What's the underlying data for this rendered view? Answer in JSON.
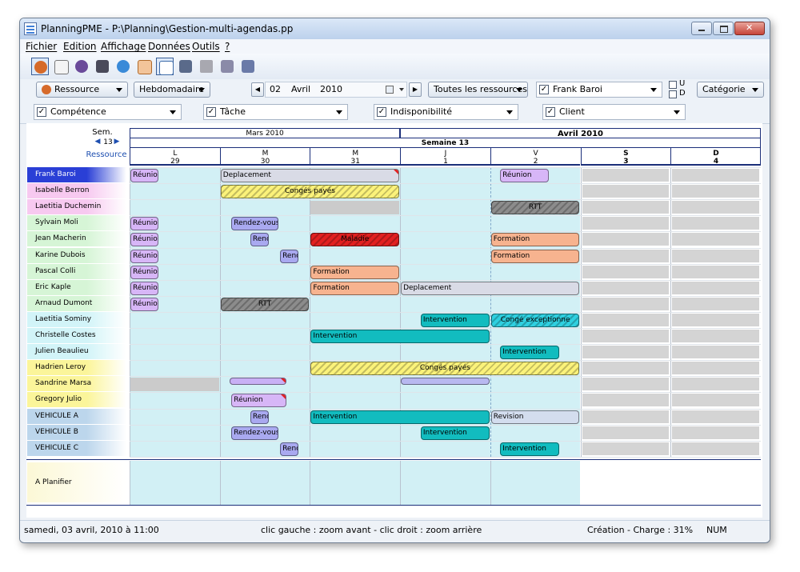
{
  "window": {
    "title": "PlanningPME - P:\\Planning\\Gestion-multi-agendas.pp"
  },
  "menu": [
    "Fichier",
    "Edition",
    "Affichage",
    "Données",
    "Outils",
    "?"
  ],
  "toolbar_icons": [
    "resources-icon",
    "calendar-icon",
    "users-icon",
    "book-icon",
    "globe-icon",
    "agenda-icon",
    "add-task-icon",
    "report-icon",
    "tools-icon",
    "filter-icon",
    "export-icon"
  ],
  "toolbar2": {
    "ressource_label": "Ressource",
    "view": "Hebdomadaire",
    "day": "02",
    "month": "Avril",
    "year": "2010",
    "filter": "Toutes les ressources",
    "person": "Frank Baroi",
    "u_label": "U",
    "d_label": "D",
    "category": "Catégorie"
  },
  "filters": [
    {
      "label": "Compétence",
      "checked": "✓"
    },
    {
      "label": "Tâche",
      "checked": "✓"
    },
    {
      "label": "Indisponibilité",
      "checked": "✓"
    },
    {
      "label": "Client",
      "checked": "✓"
    }
  ],
  "header": {
    "sem_label": "Sem.",
    "week_num": "13",
    "resource_label": "Ressource",
    "month1": "Mars 2010",
    "month2": "Avril 2010",
    "week_title": "Semaine 13",
    "days": [
      {
        "letter": "L",
        "num": "29"
      },
      {
        "letter": "M",
        "num": "30"
      },
      {
        "letter": "M",
        "num": "31"
      },
      {
        "letter": "J",
        "num": "1"
      },
      {
        "letter": "V",
        "num": "2"
      },
      {
        "letter": "S",
        "num": "3"
      },
      {
        "letter": "D",
        "num": "4"
      }
    ]
  },
  "resources": [
    {
      "name": "Frank Baroi",
      "color": "#2a3fd6",
      "text": "#ffffff"
    },
    {
      "name": "Isabelle Berron",
      "color": "#f7c9f0",
      "text": "#000000"
    },
    {
      "name": "Laetitia Duchemin",
      "color": "#f7c9f0",
      "text": "#000000"
    },
    {
      "name": "Sylvain Moli",
      "color": "#d6f5d6",
      "text": "#000000"
    },
    {
      "name": "Jean Macherin",
      "color": "#d6f5d6",
      "text": "#000000"
    },
    {
      "name": "Karine Dubois",
      "color": "#d6f5d6",
      "text": "#000000"
    },
    {
      "name": "Pascal Colli",
      "color": "#d6f5d6",
      "text": "#000000"
    },
    {
      "name": "Eric Kaple",
      "color": "#d6f5d6",
      "text": "#000000"
    },
    {
      "name": "Arnaud Dumont",
      "color": "#d6f5d6",
      "text": "#000000"
    },
    {
      "name": "Laetitia Sominy",
      "color": "#d2f4f8",
      "text": "#000000"
    },
    {
      "name": "Christelle Costes",
      "color": "#d2f4f8",
      "text": "#000000"
    },
    {
      "name": "Julien Beaulieu",
      "color": "#d2f4f8",
      "text": "#000000"
    },
    {
      "name": "Hadrien Leroy",
      "color": "#fbf59a",
      "text": "#000000"
    },
    {
      "name": "Sandrine Marsa",
      "color": "#fbf59a",
      "text": "#000000"
    },
    {
      "name": "Gregory Julio",
      "color": "#fbf59a",
      "text": "#000000"
    },
    {
      "name": "VEHICULE A",
      "color": "#bcd6ec",
      "text": "#000000"
    },
    {
      "name": "VEHICULE B",
      "color": "#bcd6ec",
      "text": "#000000"
    },
    {
      "name": "VEHICULE C",
      "color": "#bcd6ec",
      "text": "#000000"
    }
  ],
  "planifier_label": "A Planifier",
  "events": [
    {
      "row": 0,
      "start": 0,
      "end": 0.33,
      "label": "Réunion",
      "color": "#d7b6f7",
      "center": false,
      "hatch": false,
      "flag": false
    },
    {
      "row": 0,
      "start": 1,
      "end": 3,
      "label": "Deplacement",
      "color": "#d9dbe6",
      "center": false,
      "hatch": false,
      "flag": true
    },
    {
      "row": 0,
      "start": 4.1,
      "end": 4.66,
      "label": "Réunion",
      "color": "#d7b6f7",
      "center": false,
      "hatch": false,
      "flag": false
    },
    {
      "row": 1,
      "start": 1,
      "end": 3,
      "label": "Congés payés",
      "color": "#fbf27a",
      "center": true,
      "hatch": true,
      "flag": false
    },
    {
      "row": 2,
      "start": 2,
      "end": 3,
      "label": "",
      "color": "#cbcbcb",
      "center": false,
      "hatch": false,
      "flag": false,
      "plain": true
    },
    {
      "row": 2,
      "start": 4,
      "end": 5,
      "label": "RTT",
      "color": "#8c8c8c",
      "center": true,
      "hatch": true,
      "flag": false
    },
    {
      "row": 3,
      "start": 0,
      "end": 0.33,
      "label": "Réunion",
      "color": "#d7b6f7",
      "center": false,
      "hatch": false,
      "flag": false
    },
    {
      "row": 3,
      "start": 1.12,
      "end": 1.66,
      "label": "Rendez-vous",
      "color": "#a9a9f0",
      "center": false,
      "hatch": false,
      "flag": false
    },
    {
      "row": 4,
      "start": 0,
      "end": 0.33,
      "label": "Réunion",
      "color": "#d7b6f7",
      "center": false,
      "hatch": false,
      "flag": false
    },
    {
      "row": 4,
      "start": 1.33,
      "end": 1.55,
      "label": "Renc",
      "color": "#a9a9f0",
      "center": false,
      "hatch": false,
      "flag": false
    },
    {
      "row": 4,
      "start": 2,
      "end": 3,
      "label": "Maladie",
      "color": "#e22020",
      "center": true,
      "hatch": true,
      "flag": false
    },
    {
      "row": 4,
      "start": 4,
      "end": 5,
      "label": "Formation",
      "color": "#f7b38f",
      "center": false,
      "hatch": false,
      "flag": false
    },
    {
      "row": 5,
      "start": 0,
      "end": 0.33,
      "label": "Réunion",
      "color": "#d7b6f7",
      "center": false,
      "hatch": false,
      "flag": false
    },
    {
      "row": 5,
      "start": 1.66,
      "end": 1.88,
      "label": "Renc",
      "color": "#a9a9f0",
      "center": false,
      "hatch": false,
      "flag": false
    },
    {
      "row": 5,
      "start": 4,
      "end": 5,
      "label": "Formation",
      "color": "#f7b38f",
      "center": false,
      "hatch": false,
      "flag": false
    },
    {
      "row": 6,
      "start": 0,
      "end": 0.33,
      "label": "Réunion",
      "color": "#d7b6f7",
      "center": false,
      "hatch": false,
      "flag": false
    },
    {
      "row": 6,
      "start": 2,
      "end": 3,
      "label": "Formation",
      "color": "#f7b38f",
      "center": false,
      "hatch": false,
      "flag": false
    },
    {
      "row": 7,
      "start": 0,
      "end": 0.33,
      "label": "Réunion",
      "color": "#d7b6f7",
      "center": false,
      "hatch": false,
      "flag": false
    },
    {
      "row": 7,
      "start": 2,
      "end": 3,
      "label": "Formation",
      "color": "#f7b38f",
      "center": false,
      "hatch": false,
      "flag": false
    },
    {
      "row": 7,
      "start": 3,
      "end": 5,
      "label": "Deplacement",
      "color": "#d9dbe6",
      "center": false,
      "hatch": false,
      "flag": false
    },
    {
      "row": 8,
      "start": 0,
      "end": 0.33,
      "label": "Réunion",
      "color": "#d7b6f7",
      "center": false,
      "hatch": false,
      "flag": false
    },
    {
      "row": 8,
      "start": 1,
      "end": 2,
      "label": "RTT",
      "color": "#8c8c8c",
      "center": true,
      "hatch": true,
      "flag": false
    },
    {
      "row": 9,
      "start": 3.22,
      "end": 4,
      "label": "Intervention",
      "color": "#12bcbf",
      "center": false,
      "hatch": false,
      "flag": false
    },
    {
      "row": 9,
      "start": 4,
      "end": 5,
      "label": "Congé exceptionne",
      "color": "#2fd0e0",
      "center": true,
      "hatch": true,
      "flag": false
    },
    {
      "row": 10,
      "start": 2,
      "end": 4,
      "label": "Intervention",
      "color": "#12bcbf",
      "center": false,
      "hatch": false,
      "flag": false
    },
    {
      "row": 11,
      "start": 4.1,
      "end": 4.77,
      "label": "Intervention",
      "color": "#12bcbf",
      "center": false,
      "hatch": false,
      "flag": false
    },
    {
      "row": 12,
      "start": 2,
      "end": 5,
      "label": "Congés payés",
      "color": "#fbf27a",
      "center": true,
      "hatch": true,
      "flag": false
    },
    {
      "row": 13,
      "start": 0,
      "end": 1,
      "label": "",
      "color": "#cbcbcb",
      "center": false,
      "hatch": false,
      "flag": false,
      "plain": true
    },
    {
      "row": 13,
      "start": 1.1,
      "end": 1.75,
      "label": "",
      "color": "#c8b0f5",
      "center": false,
      "hatch": false,
      "flag": true,
      "thin": true
    },
    {
      "row": 13,
      "start": 3,
      "end": 4,
      "label": "",
      "color": "#b8b8f0",
      "center": false,
      "hatch": false,
      "flag": false,
      "thin": true
    },
    {
      "row": 14,
      "start": 1.12,
      "end": 1.75,
      "label": "Réunion",
      "color": "#d7b6f7",
      "center": false,
      "hatch": false,
      "flag": true
    },
    {
      "row": 15,
      "start": 1.33,
      "end": 1.55,
      "label": "Renc",
      "color": "#a9a9f0",
      "center": false,
      "hatch": false,
      "flag": false
    },
    {
      "row": 15,
      "start": 2,
      "end": 4,
      "label": "Intervention",
      "color": "#12bcbf",
      "center": false,
      "hatch": false,
      "flag": false
    },
    {
      "row": 15,
      "start": 4,
      "end": 5,
      "label": "Revision",
      "color": "#d3ddee",
      "center": false,
      "hatch": false,
      "flag": false
    },
    {
      "row": 16,
      "start": 1.12,
      "end": 1.66,
      "label": "Rendez-vous",
      "color": "#a9a9f0",
      "center": false,
      "hatch": false,
      "flag": false
    },
    {
      "row": 16,
      "start": 3.22,
      "end": 4,
      "label": "Intervention",
      "color": "#12bcbf",
      "center": false,
      "hatch": false,
      "flag": false
    },
    {
      "row": 17,
      "start": 1.66,
      "end": 1.88,
      "label": "Renc",
      "color": "#a9a9f0",
      "center": false,
      "hatch": false,
      "flag": false
    },
    {
      "row": 17,
      "start": 4.1,
      "end": 4.77,
      "label": "Intervention",
      "color": "#12bcbf",
      "center": false,
      "hatch": false,
      "flag": false
    }
  ],
  "status": {
    "datetime": "samedi, 03 avril, 2010 à 11:00",
    "hint": "clic gauche : zoom avant - clic droit : zoom arrière",
    "load": "Création - Charge : 31%",
    "num": "NUM"
  },
  "colors": {
    "weekday_bg": "#d2f0f5",
    "weekend_bg": "#d4d4d4",
    "grid_line": "#b9c2cf",
    "header_line": "#1b2f7a"
  }
}
